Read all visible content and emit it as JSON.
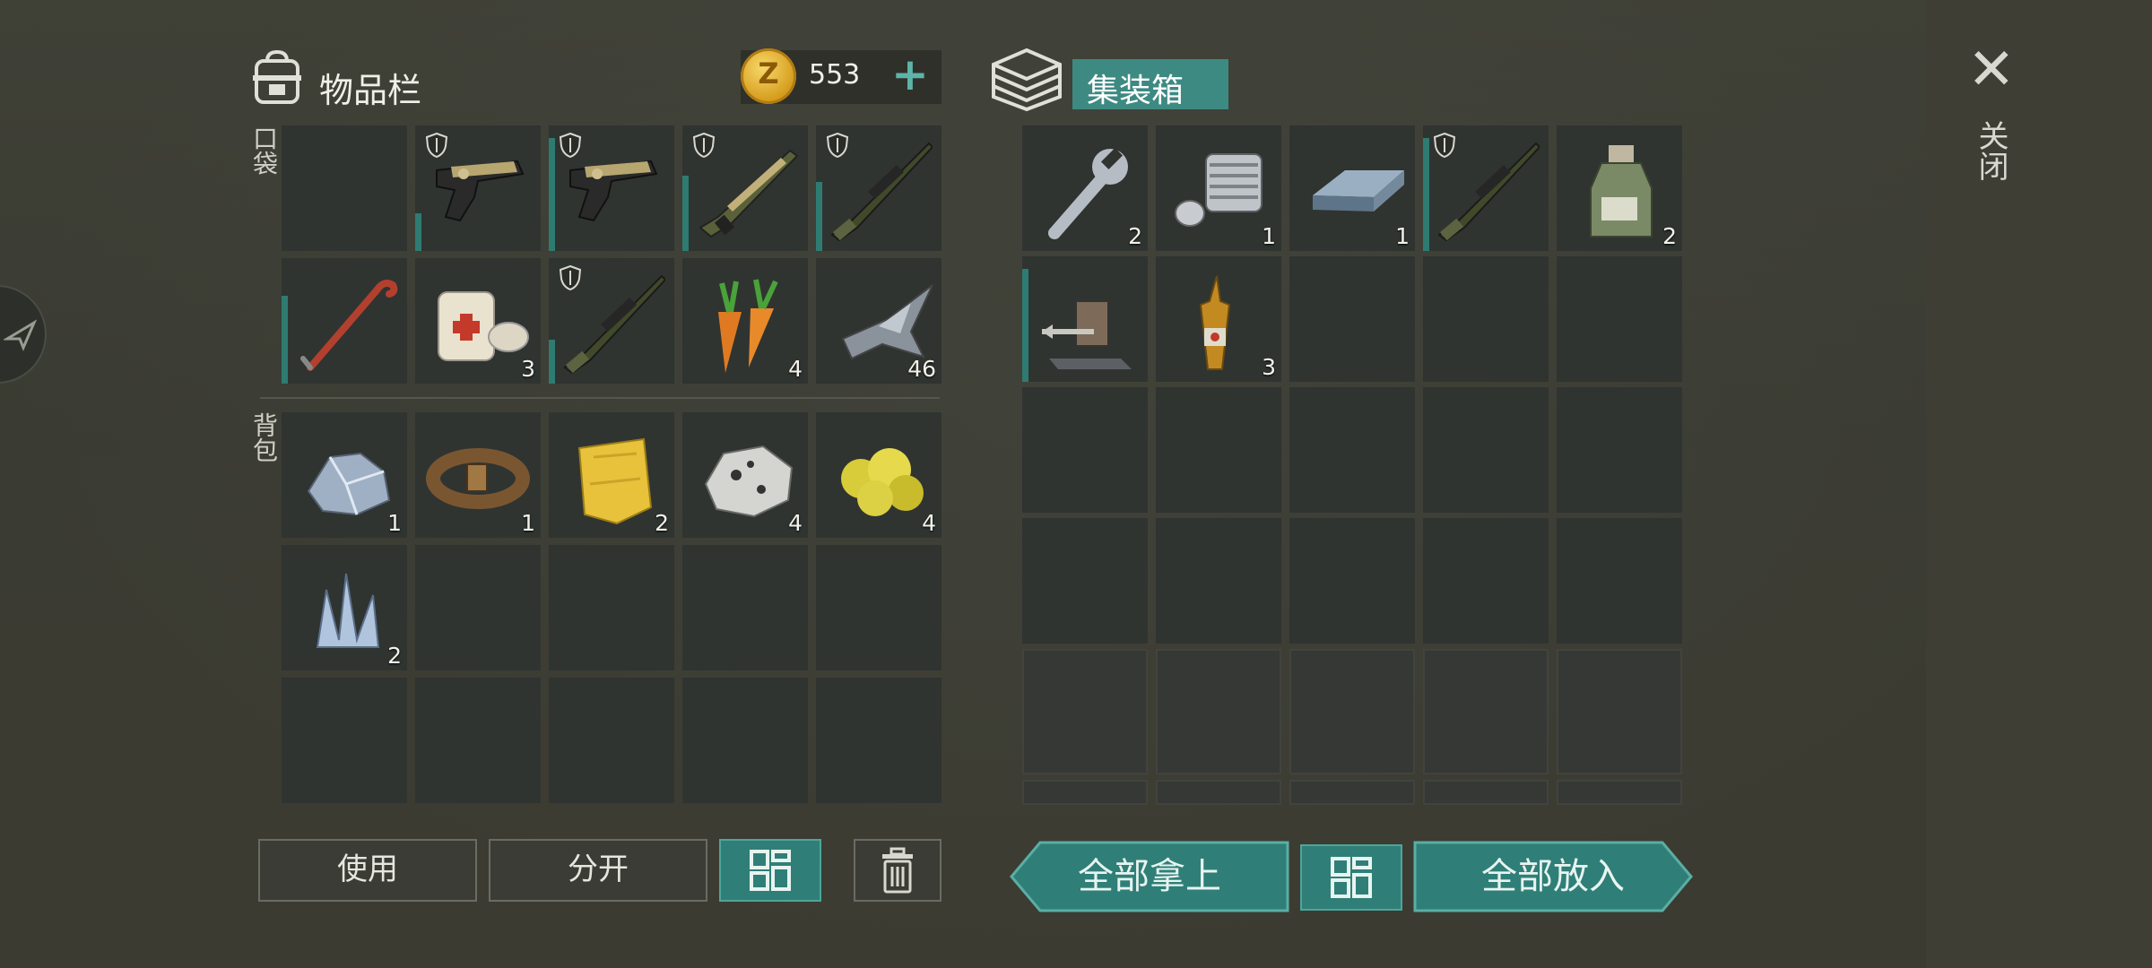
{
  "inventory": {
    "title": "物品栏",
    "coins": "553",
    "pocket_label": "口袋",
    "backpack_label": "背包",
    "pocket_slots": [
      {
        "item": "",
        "count": ""
      },
      {
        "item": "pistol",
        "count": "",
        "shield": true,
        "bar": 0.3
      },
      {
        "item": "pistol",
        "count": "",
        "shield": true,
        "bar": 0.9
      },
      {
        "item": "shotgun",
        "count": "",
        "shield": true,
        "bar": 0.6
      },
      {
        "item": "sniper-rifle",
        "count": "",
        "shield": true,
        "bar": 0.55
      },
      {
        "item": "crowbar",
        "count": "",
        "bar": 0.7
      },
      {
        "item": "bandage",
        "count": "3"
      },
      {
        "item": "sniper-rifle",
        "count": "",
        "shield": true,
        "bar": 0.35
      },
      {
        "item": "carrot",
        "count": "4"
      },
      {
        "item": "metal-scrap",
        "count": "46"
      }
    ],
    "backpack_slots": [
      {
        "item": "iron-ore",
        "count": "1"
      },
      {
        "item": "leather-belt",
        "count": "1"
      },
      {
        "item": "cloth",
        "count": "2"
      },
      {
        "item": "stone",
        "count": "4"
      },
      {
        "item": "sulfur",
        "count": "4"
      },
      {
        "item": "crystal",
        "count": "2"
      },
      {
        "item": "",
        "count": ""
      },
      {
        "item": "",
        "count": ""
      },
      {
        "item": "",
        "count": ""
      },
      {
        "item": "",
        "count": ""
      },
      {
        "item": "",
        "count": ""
      },
      {
        "item": "",
        "count": ""
      },
      {
        "item": "",
        "count": ""
      },
      {
        "item": "",
        "count": ""
      },
      {
        "item": "",
        "count": ""
      }
    ],
    "buttons": {
      "use": "使用",
      "split": "分开"
    }
  },
  "container": {
    "title": "集装箱",
    "slots": [
      {
        "item": "wrench",
        "count": "2"
      },
      {
        "item": "engine-part",
        "count": "1"
      },
      {
        "item": "metal-ingot",
        "count": "1"
      },
      {
        "item": "sniper-rifle",
        "count": "",
        "shield": true,
        "bar": 0.9
      },
      {
        "item": "bottle",
        "count": "2"
      },
      {
        "item": "crossbow-trap",
        "count": "",
        "bar": 0.9
      },
      {
        "item": "ampoule",
        "count": "3"
      }
    ],
    "buttons": {
      "take_all": "全部拿上",
      "put_all": "全部放入"
    }
  },
  "close_label": "关闭",
  "colors": {
    "accent": "#2f7f78",
    "slot": "#2f3431",
    "durability": "#2e7b72"
  }
}
